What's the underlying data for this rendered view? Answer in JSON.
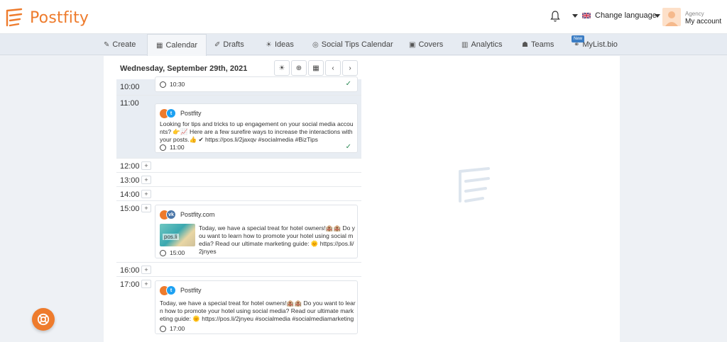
{
  "brand": {
    "name": "Postfity",
    "color": "#ee7b2c"
  },
  "header": {
    "language_label": "Change language",
    "account_role": "Agency",
    "account_name": "My account"
  },
  "nav": {
    "items": [
      {
        "label": "Create",
        "icon": "edit-icon"
      },
      {
        "label": "Calendar",
        "icon": "calendar-icon",
        "active": true
      },
      {
        "label": "Drafts",
        "icon": "pencil-icon"
      },
      {
        "label": "Ideas",
        "icon": "lightbulb-icon"
      },
      {
        "label": "Social Tips Calendar",
        "icon": "compass-icon"
      },
      {
        "label": "Covers",
        "icon": "image-icon"
      },
      {
        "label": "Analytics",
        "icon": "bar-chart-icon"
      },
      {
        "label": "Teams",
        "icon": "users-icon"
      },
      {
        "label": "MyList.bio",
        "icon": "link-icon"
      }
    ],
    "new_badge": "New"
  },
  "calendar": {
    "date_title": "Wednesday, September 29th, 2021",
    "slots": {
      "s1000": {
        "time": "10:00"
      },
      "s1100": {
        "time": "11:00"
      },
      "s1200": {
        "time": "12:00"
      },
      "s1300": {
        "time": "13:00"
      },
      "s1400": {
        "time": "14:00"
      },
      "s1500": {
        "time": "15:00"
      },
      "s1600": {
        "time": "16:00"
      },
      "s1700": {
        "time": "17:00"
      }
    },
    "posts": {
      "p1030": {
        "time": "10:30"
      },
      "p1100": {
        "account": "Postfity",
        "network": "twitter",
        "text": "Looking for tips and tricks to up engagement on your social media accounts? 👉📈 Here are a few surefire ways to increase the interactions with your posts.👍 ✔ https://pos.li/2jaxqv #socialmedia #BizTips",
        "time": "11:00"
      },
      "p1500": {
        "account": "Postfity.com",
        "network": "vk",
        "link_label": "pos.li",
        "text": "Today, we have a special treat for hotel owners!🏨🏨 Do you want to learn how to promote your hotel using social media? Read our ultimate marketing guide: 🌞 https://pos.li/2jnyes",
        "time": "15:00"
      },
      "p1700": {
        "account": "Postfity",
        "network": "twitter",
        "text": "Today, we have a special treat for hotel owners!🏨🏨 Do you want to learn how to promote your hotel using social media? Read our ultimate marketing guide: 🌞 https://pos.li/2jnyeu #socialmedia #socialmediamarketing #marketing ...",
        "time": "17:00"
      }
    }
  }
}
